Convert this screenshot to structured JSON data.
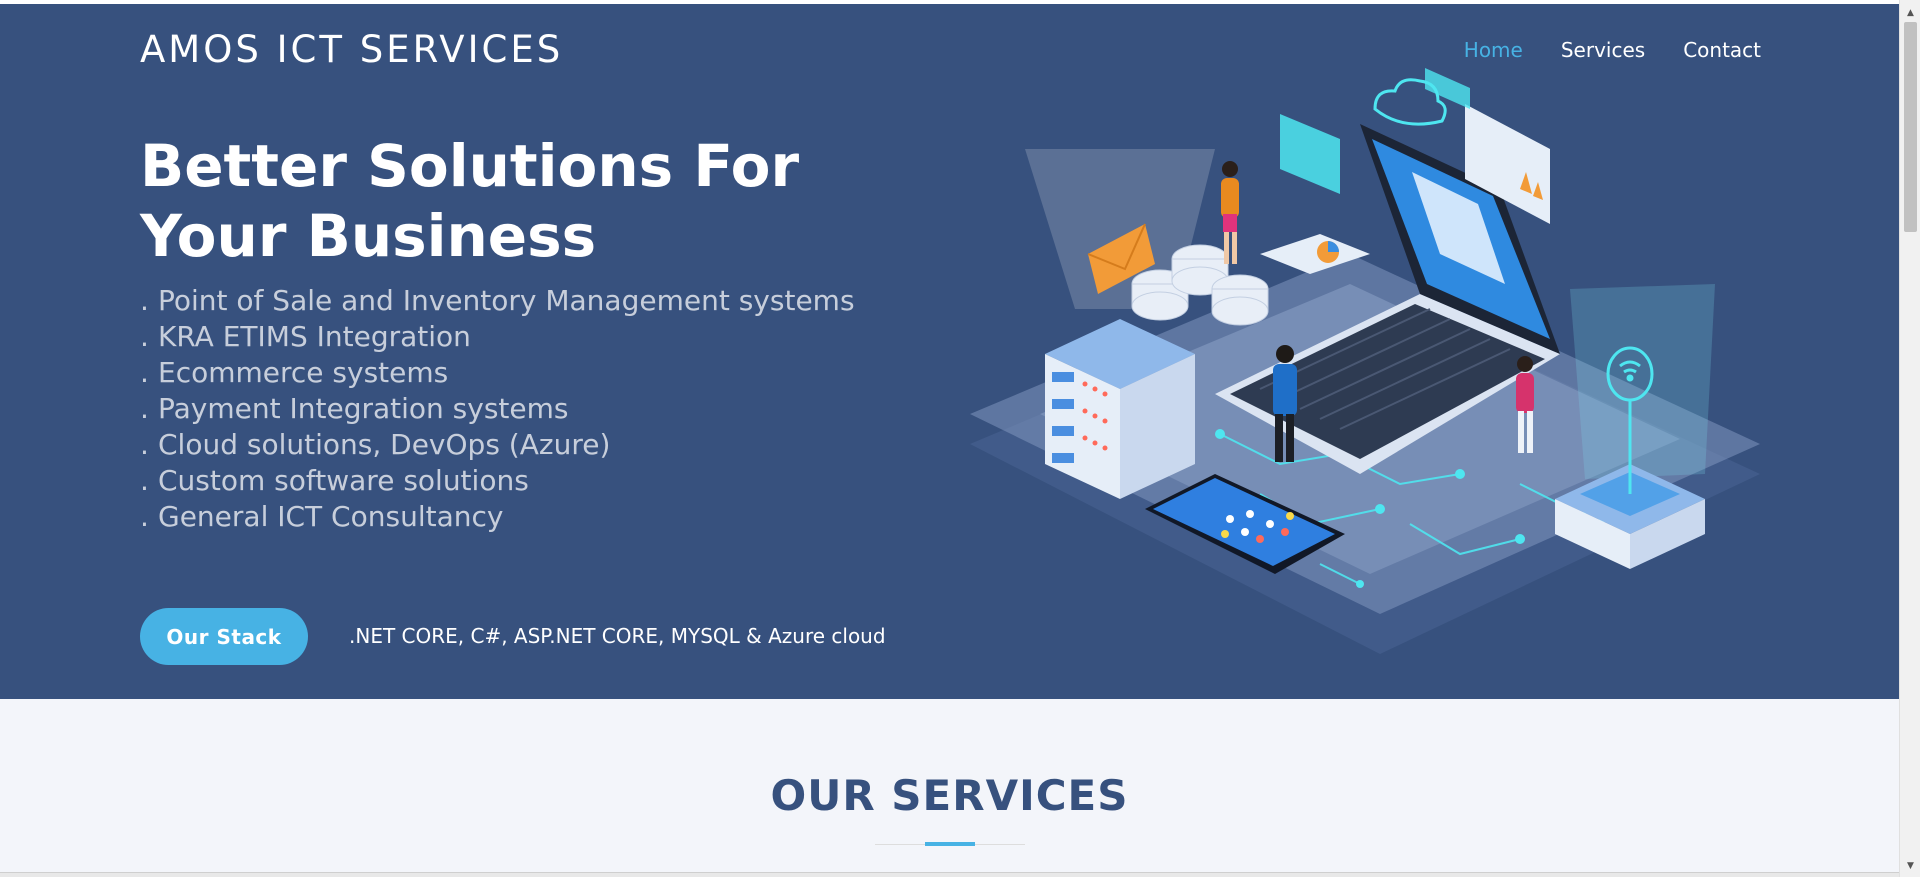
{
  "header": {
    "logo": "AMOS ICT SERVICES",
    "nav": [
      {
        "label": "Home",
        "active": true
      },
      {
        "label": "Services",
        "active": false
      },
      {
        "label": "Contact",
        "active": false
      }
    ]
  },
  "hero": {
    "title": "Better Solutions For Your Business",
    "features": [
      "Point of Sale and Inventory Management systems",
      "KRA ETIMS Integration",
      "Ecommerce systems",
      "Payment Integration systems",
      "Cloud solutions, DevOps (Azure)",
      "Custom software solutions",
      "General ICT Consultancy"
    ],
    "bullet": ".",
    "button_label": "Our Stack",
    "stack_text": ".NET CORE, C#, ASP.NET CORE, MYSQL & Azure cloud"
  },
  "services": {
    "title": "OUR SERVICES"
  },
  "scrollbar": {
    "up_icon": "▲",
    "down_icon": "▼"
  },
  "colors": {
    "hero_bg": "#37517e",
    "accent": "#47b2e4",
    "section_bg": "#f3f5fa"
  }
}
